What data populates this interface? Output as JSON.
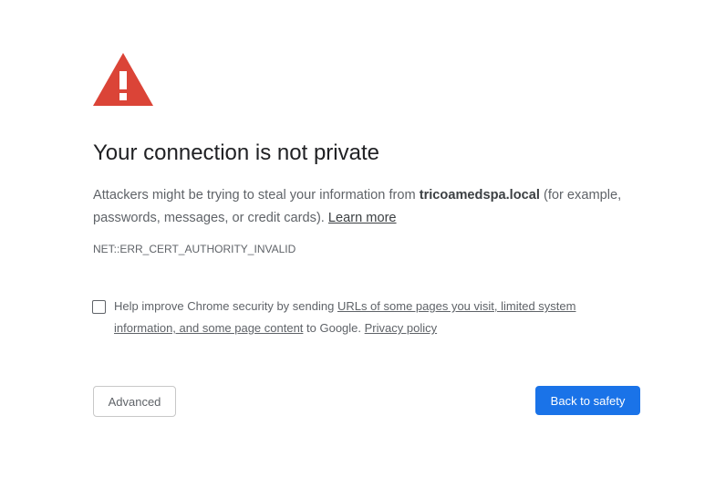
{
  "colors": {
    "icon_red": "#db4437",
    "primary_button": "#1a73e8",
    "body_text": "#5f6368",
    "title_text": "#202124"
  },
  "icon": "warning-triangle-icon",
  "title": "Your connection is not private",
  "message": {
    "prefix": "Attackers might be trying to steal your information from ",
    "host": "tricoamedspa.local",
    "suffix": " (for example, passwords, messages, or credit cards). ",
    "learn_more": "Learn more"
  },
  "error_code": "NET::ERR_CERT_AUTHORITY_INVALID",
  "optin": {
    "checked": false,
    "prefix": "Help improve Chrome security by sending ",
    "link1": "URLs of some pages you visit, limited system information, and some page content",
    "middle": " to Google. ",
    "privacy": "Privacy policy"
  },
  "buttons": {
    "advanced": "Advanced",
    "back_to_safety": "Back to safety"
  }
}
